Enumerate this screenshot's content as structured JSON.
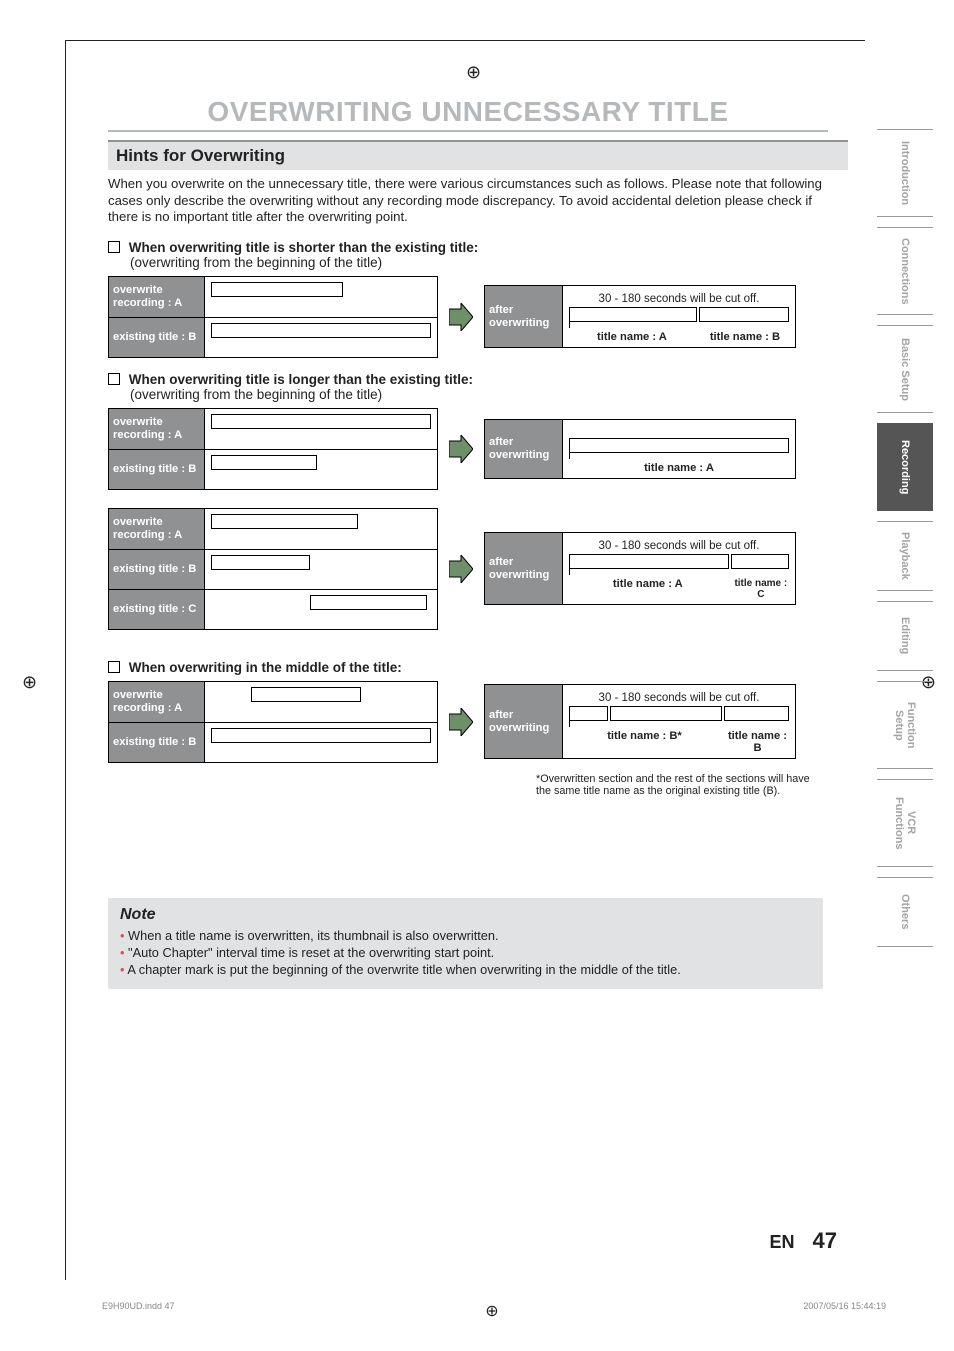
{
  "header": "OVERWRITING UNNECESSARY TITLE",
  "section": "Hints for Overwriting",
  "intro": "When you overwrite on the unnecessary title, there were various circumstances such as follows.  Please note that following cases only describe the overwriting without any recording mode discrepancy.  To avoid accidental deletion please check if there is no important title after the overwriting point.",
  "case1": {
    "bold": "When overwriting title is shorter than the existing title:",
    "light": "(overwriting from the beginning of the title)"
  },
  "case2": {
    "bold": "When overwriting title is longer than the existing title:",
    "light": "(overwriting from the beginning of the title)"
  },
  "case3": {
    "bold": "When overwriting in the middle of the title:"
  },
  "labels": {
    "ow": "overwrite recording : A",
    "exB": "existing title : B",
    "exC": "existing title : C",
    "after": "after overwriting",
    "cutoff": "30 - 180 seconds will be cut off.",
    "titleA": "title name : A",
    "titleB": "title name : B",
    "titleC": "title name : C",
    "titleBstar": "title name : B*"
  },
  "footnote": "*Overwritten section and the rest of the sections will have the same title name as the original existing title (B).",
  "note_title": "Note",
  "notes": [
    "When a title name is overwritten, its thumbnail is also overwritten.",
    "\"Auto Chapter\" interval time is reset at the overwriting start point.",
    "A chapter mark is put the beginning of the overwrite title when overwriting in the middle of the title."
  ],
  "footer": {
    "lang": "EN",
    "page": "47"
  },
  "tabs": [
    "Introduction",
    "Connections",
    "Basic Setup",
    "Recording",
    "Playback",
    "Editing",
    "Function Setup",
    "VCR Functions",
    "Others"
  ],
  "footline": {
    "left": "E9H90UD.indd   47",
    "right": "2007/05/16   15:44:19"
  }
}
